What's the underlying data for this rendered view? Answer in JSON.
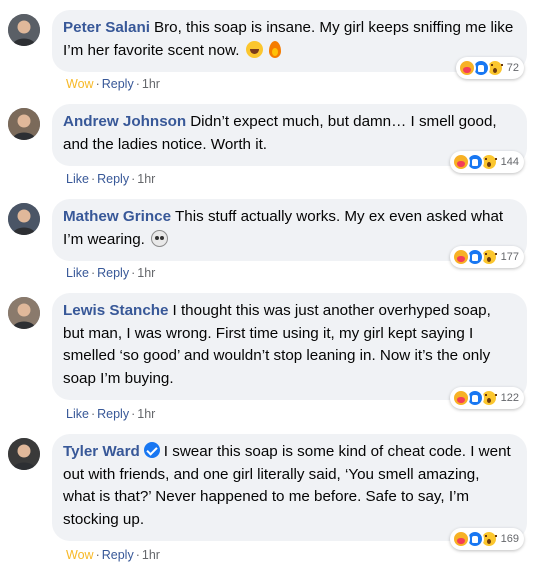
{
  "comments": [
    {
      "author": "Peter Salani",
      "verified": false,
      "text": "Bro, this soap is insane. My girl keeps sniffing me like I’m her favorite scent now.",
      "emojis": [
        "grinning-squinting-emoji",
        "fire-emoji"
      ],
      "reaction": {
        "label": "Wow",
        "color": "#f7b928"
      },
      "reply": "Reply",
      "time": "1hr",
      "reaction_count": "72",
      "avatar_color": "#5a5f66"
    },
    {
      "author": "Andrew Johnson",
      "verified": false,
      "text": "Didn’t expect much, but damn… I smell good, and the ladies notice. Worth it.",
      "emojis": [],
      "reaction": {
        "label": "Like",
        "color": "#385898"
      },
      "reply": "Reply",
      "time": "1hr",
      "reaction_count": "144",
      "avatar_color": "#7b6a5a"
    },
    {
      "author": "Mathew Grince",
      "verified": false,
      "text": "This stuff actually works. My ex even asked what I’m wearing.",
      "emojis": [
        "skull-emoji"
      ],
      "reaction": {
        "label": "Like",
        "color": "#385898"
      },
      "reply": "Reply",
      "time": "1hr",
      "reaction_count": "177",
      "avatar_color": "#4a5566"
    },
    {
      "author": "Lewis Stanche",
      "verified": false,
      "text": "I thought this was just another overhyped soap, but man, I was wrong. First time using it, my girl kept saying I smelled ‘so good’ and wouldn’t stop leaning in. Now it’s the only soap I’m buying.",
      "emojis": [],
      "reaction": {
        "label": "Like",
        "color": "#385898"
      },
      "reply": "Reply",
      "time": "1hr",
      "reaction_count": "122",
      "avatar_color": "#8a7a6c"
    },
    {
      "author": "Tyler Ward",
      "verified": true,
      "text": "I swear this soap is some kind of cheat code. I went out with friends, and one girl literally said, ‘You smell amazing, what is that?’ Never happened to me before. Safe to say, I’m stocking up.",
      "emojis": [],
      "reaction": {
        "label": "Wow",
        "color": "#f7b928"
      },
      "reply": "Reply",
      "time": "1hr",
      "reaction_count": "169",
      "avatar_color": "#3a3a3a"
    }
  ],
  "separator": "·"
}
